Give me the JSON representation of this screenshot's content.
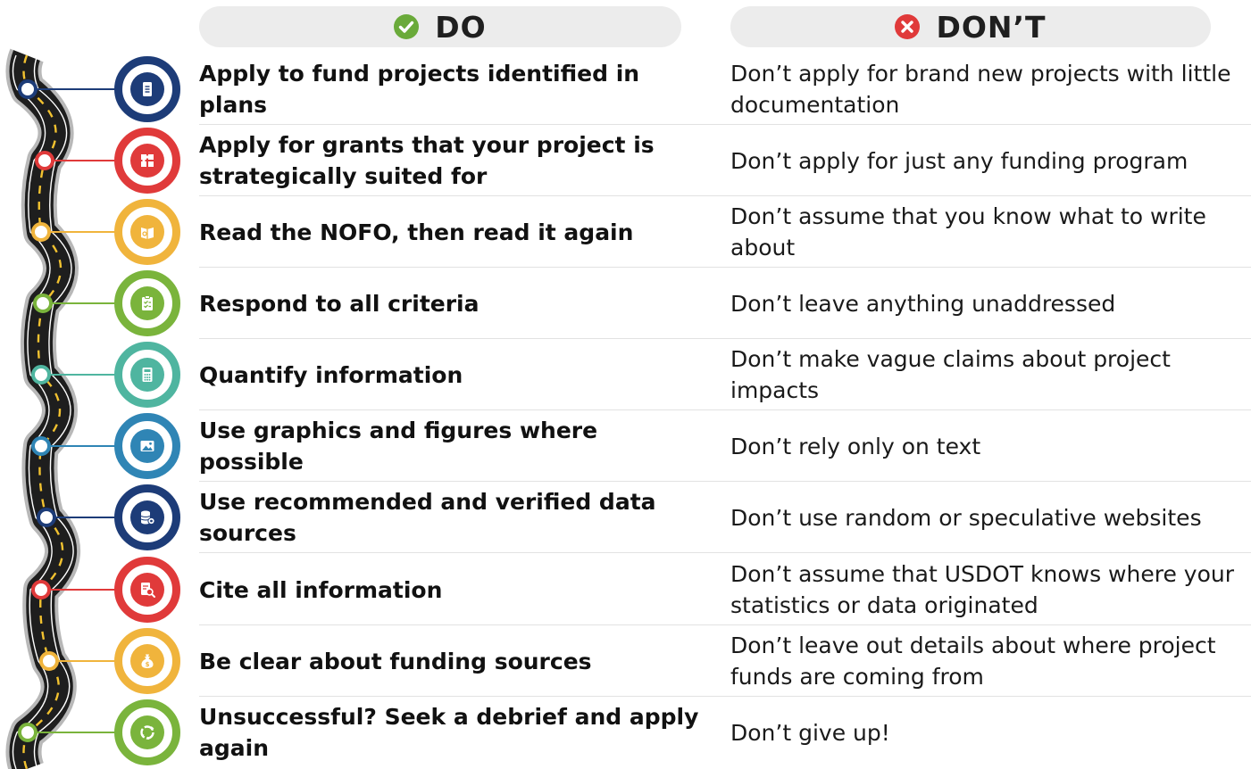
{
  "headers": {
    "do": "DO",
    "dont": "DON’T",
    "do_icon": "check-circle-icon",
    "dont_icon": "x-circle-icon",
    "do_color": "#6aaa3a",
    "dont_color": "#e03a3a"
  },
  "rows": [
    {
      "do": "Apply to fund projects identified in plans",
      "dont": "Don’t apply for brand new projects with little documentation",
      "icon": "document-icon",
      "color": "#1d3c78"
    },
    {
      "do": "Apply for grants that your project is strategically suited for",
      "dont": "Don’t apply for just any funding program",
      "icon": "puzzle-icon",
      "color": "#e03a3a"
    },
    {
      "do": "Read the NOFO, then read it again",
      "dont": "Don’t assume that you know what to write about",
      "icon": "reading-icon",
      "color": "#f0b43c"
    },
    {
      "do": "Respond to all criteria",
      "dont": "Don’t leave anything unaddressed",
      "icon": "checklist-icon",
      "color": "#7ab43c"
    },
    {
      "do": "Quantify information",
      "dont": "Don’t make vague claims about project impacts",
      "icon": "calculator-icon",
      "color": "#4fb5a0"
    },
    {
      "do": "Use graphics and figures where possible",
      "dont": "Don’t rely only on text",
      "icon": "image-icon",
      "color": "#2f85b5"
    },
    {
      "do": "Use recommended and verified data sources",
      "dont": "Don’t use random or speculative websites",
      "icon": "database-gear-icon",
      "color": "#1d3c78"
    },
    {
      "do": "Cite all information",
      "dont": "Don’t assume that USDOT knows where your statistics or data originated",
      "icon": "search-document-icon",
      "color": "#e03a3a"
    },
    {
      "do": "Be clear about funding sources",
      "dont": "Don’t leave out details about where project funds are coming from",
      "icon": "money-bag-icon",
      "color": "#f0b43c"
    },
    {
      "do": "Unsuccessful? Seek a debrief and apply again",
      "dont": "Don’t give up!",
      "icon": "cycle-arrows-icon",
      "color": "#7ab43c"
    }
  ]
}
